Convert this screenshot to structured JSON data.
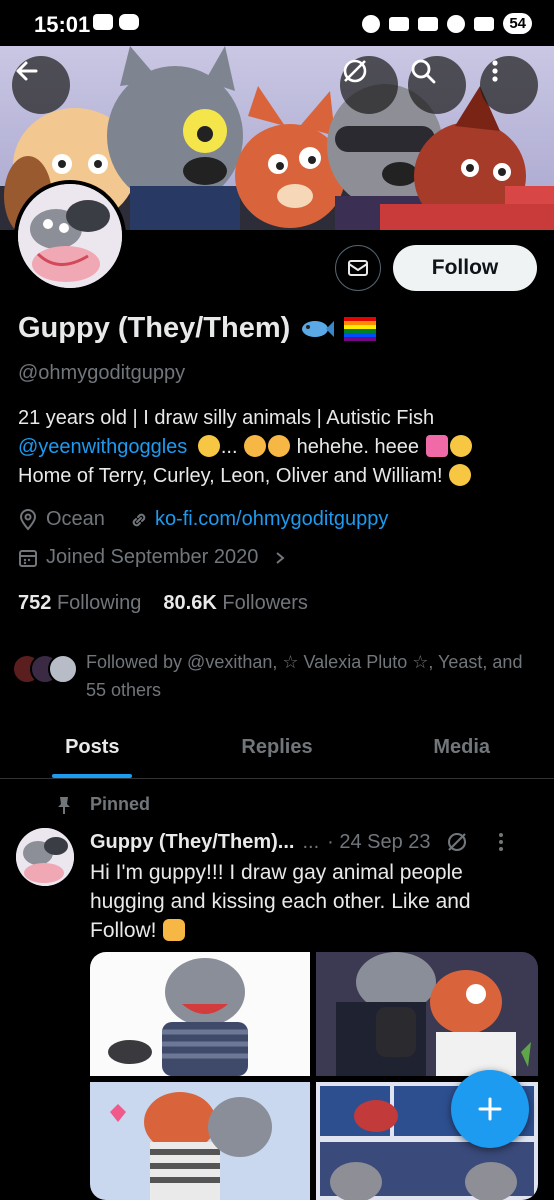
{
  "status_bar": {
    "time": "15:01",
    "battery": "54"
  },
  "profile": {
    "display_name": "Guppy (They/Them)",
    "handle": "@ohmygoditguppy",
    "follow_label": "Follow",
    "bio_line1": "21 years old | I draw silly animals | Autistic Fish",
    "bio_mention": "@yeenwithgoggles",
    "bio_line2_rest": "... ",
    "bio_line2_end": " hehehe. heee ",
    "bio_line3": "Home of Terry, Curley, Leon, Oliver and William! ",
    "location": "Ocean",
    "website": "ko-fi.com/ohmygoditguppy",
    "joined": "Joined September 2020",
    "following_count": "752",
    "following_label": "Following",
    "followers_count": "80.6K",
    "followers_label": "Followers",
    "followed_by": "Followed by @vexithan, ☆ Valexia Pluto ☆, Yeast, and 55 others"
  },
  "tabs": [
    "Posts",
    "Replies",
    "Media"
  ],
  "post": {
    "pinned_label": "Pinned",
    "author": "Guppy (They/Them)...",
    "ellipsis": "...",
    "date": "· 24 Sep 23",
    "text": "Hi I'm guppy!!! I draw gay animal people hugging and kissing each other. Like and Follow! "
  },
  "colors": {
    "accent": "#1d9bf0",
    "background": "#000000",
    "muted": "#71767b"
  },
  "icons": [
    "back-arrow-icon",
    "grok-icon",
    "search-icon",
    "more-vertical-icon",
    "mail-icon",
    "location-icon",
    "link-icon",
    "calendar-icon",
    "chevron-right-icon",
    "pin-icon",
    "plus-icon"
  ]
}
